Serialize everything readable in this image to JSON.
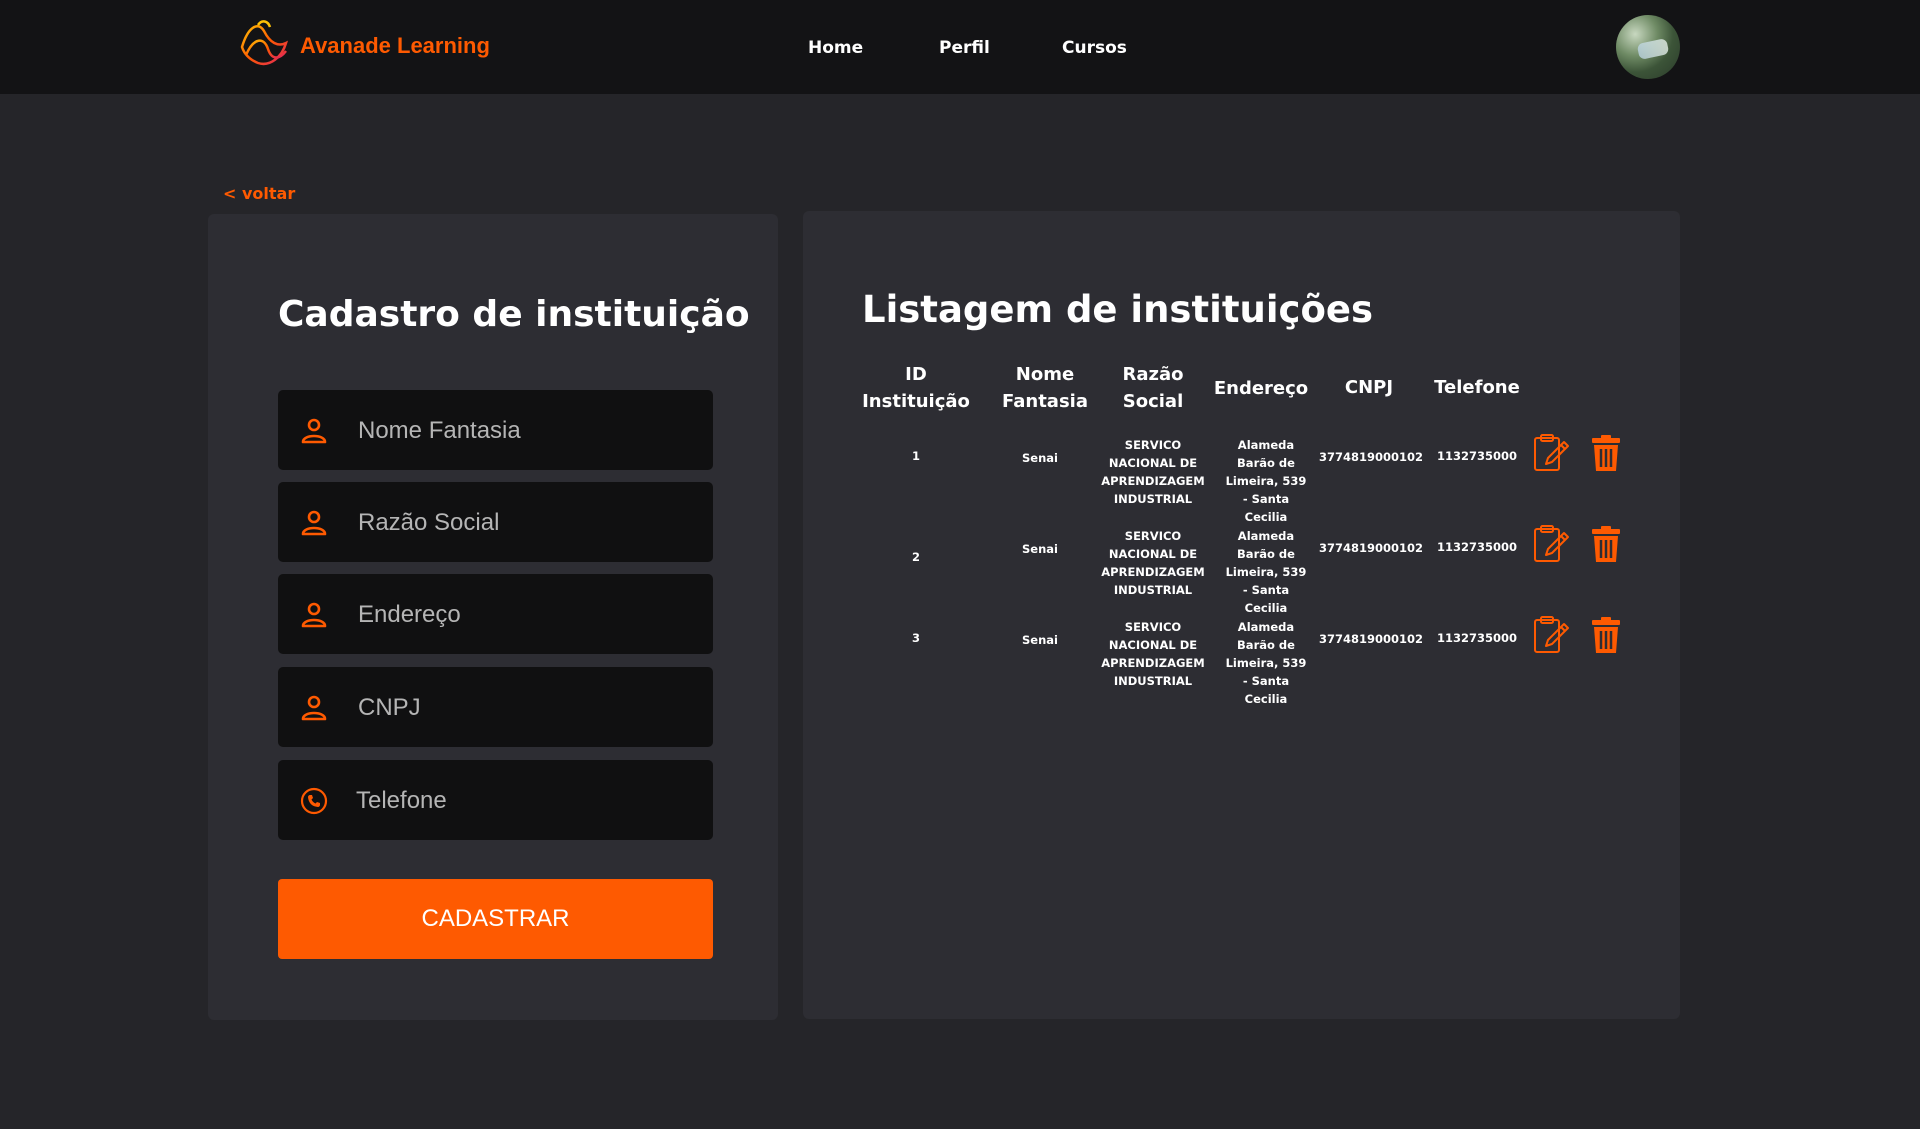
{
  "brand": {
    "name": "Avanade Learning"
  },
  "nav": {
    "items": [
      "Home",
      "Perfil",
      "Cursos"
    ]
  },
  "back_link": "< voltar",
  "form": {
    "title": "Cadastro de instituição",
    "fields": [
      {
        "placeholder": "Nome Fantasia",
        "value": "",
        "icon": "user-icon"
      },
      {
        "placeholder": "Razão Social",
        "value": "",
        "icon": "user-icon"
      },
      {
        "placeholder": "Endereço",
        "value": "",
        "icon": "user-icon"
      },
      {
        "placeholder": "CNPJ",
        "value": "",
        "icon": "user-icon"
      },
      {
        "placeholder": "Telefone",
        "value": "",
        "icon": "phone-icon"
      }
    ],
    "submit_label": "CADASTRAR"
  },
  "listing": {
    "title": "Listagem de instituições",
    "headers": [
      "ID Instituição",
      "Nome Fantasia",
      "Razão Social",
      "Endereço",
      "CNPJ",
      "Telefone"
    ],
    "rows": [
      {
        "id": "1",
        "nome_fantasia": "Senai",
        "razao_social": "SERVICO NACIONAL DE APRENDIZAGEM INDUSTRIAL",
        "endereco": "Alameda Barão de Limeira, 539 - Santa Cecilia",
        "cnpj": "3774819000102",
        "telefone": "1132735000"
      },
      {
        "id": "2",
        "nome_fantasia": "Senai",
        "razao_social": "SERVICO NACIONAL DE APRENDIZAGEM INDUSTRIAL",
        "endereco": "Alameda Barão de Limeira, 539 - Santa Cecilia",
        "cnpj": "3774819000102",
        "telefone": "1132735000"
      },
      {
        "id": "3",
        "nome_fantasia": "Senai",
        "razao_social": "SERVICO NACIONAL DE APRENDIZAGEM INDUSTRIAL",
        "endereco": "Alameda Barão de Limeira, 539 - Santa Cecilia",
        "cnpj": "3774819000102",
        "telefone": "1132735000"
      }
    ],
    "row_actions": [
      "edit-icon",
      "trash-icon"
    ]
  },
  "colors": {
    "accent": "#fe5a01",
    "background": "#252529",
    "topbar": "#131315",
    "panel": "#2d2d33",
    "input": "#101011"
  }
}
